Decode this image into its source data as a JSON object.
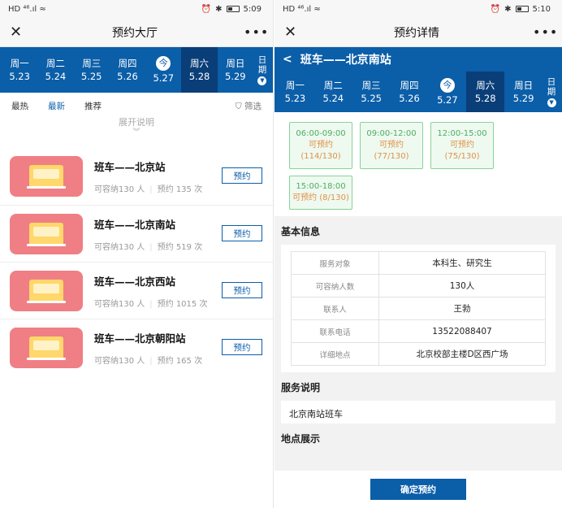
{
  "left": {
    "status": {
      "time": "5:09",
      "icons": "HD ⁴⁶.ıl ≈"
    },
    "nav": {
      "title": "预约大厅"
    },
    "week": [
      {
        "name": "周一",
        "date": "5.23"
      },
      {
        "name": "周二",
        "date": "5.24"
      },
      {
        "name": "周三",
        "date": "5.25"
      },
      {
        "name": "周四",
        "date": "5.26"
      },
      {
        "name": "今",
        "date": "5.27"
      },
      {
        "name": "周六",
        "date": "5.28"
      },
      {
        "name": "周日",
        "date": "5.29"
      }
    ],
    "date_more": {
      "line1": "日",
      "line2": "期"
    },
    "tabs": {
      "hot": "最热",
      "new": "最新",
      "recommend": "推荐",
      "filter": "筛选"
    },
    "expand": "展开说明",
    "items": [
      {
        "name": "班车——北京站",
        "capacity": "可容纳130 人",
        "count": "预约 135 次",
        "btn": "预约"
      },
      {
        "name": "班车——北京南站",
        "capacity": "可容纳130 人",
        "count": "预约 519 次",
        "btn": "预约"
      },
      {
        "name": "班车——北京西站",
        "capacity": "可容纳130 人",
        "count": "预约 1015 次",
        "btn": "预约"
      },
      {
        "name": "班车——北京朝阳站",
        "capacity": "可容纳130 人",
        "count": "预约 165 次",
        "btn": "预约"
      }
    ]
  },
  "right": {
    "status": {
      "time": "5:10",
      "icons": "HD ⁴⁶.ıl ≈"
    },
    "nav": {
      "title": "预约详情"
    },
    "route": {
      "back": "<",
      "title": "班车——北京南站"
    },
    "week": [
      {
        "name": "周一",
        "date": "5.23"
      },
      {
        "name": "周二",
        "date": "5.24"
      },
      {
        "name": "周三",
        "date": "5.25"
      },
      {
        "name": "周四",
        "date": "5.26"
      },
      {
        "name": "今",
        "date": "5.27"
      },
      {
        "name": "周六",
        "date": "5.28"
      },
      {
        "name": "周日",
        "date": "5.29"
      }
    ],
    "date_more": {
      "line1": "日",
      "line2": "期"
    },
    "slots": [
      {
        "time": "06:00-09:00",
        "status": "可预约",
        "count": "(114/130)"
      },
      {
        "time": "09:00-12:00",
        "status": "可预约",
        "count": "(77/130)"
      },
      {
        "time": "12:00-15:00",
        "status": "可预约",
        "count": "(75/130)"
      },
      {
        "time": "15:00-18:00",
        "status": "可预约 (8/130)",
        "count": ""
      }
    ],
    "basic_title": "基本信息",
    "info": [
      {
        "k": "服务对象",
        "v": "本科生、研究生"
      },
      {
        "k": "可容纳人数",
        "v": "130人"
      },
      {
        "k": "联系人",
        "v": "王勃"
      },
      {
        "k": "联系电话",
        "v": "13522088407"
      },
      {
        "k": "详细地点",
        "v": "北京校部主楼D区西广场"
      }
    ],
    "service_title": "服务说明",
    "service_desc": "北京南站班车",
    "location_title": "地点展示",
    "confirm": "确定预约"
  },
  "colors": {
    "primary": "#0b5ea8",
    "selected_day": "#0a3e78",
    "slot_green": "#4cae62",
    "slot_orange": "#e29044",
    "thumb": "#ef7f85"
  }
}
